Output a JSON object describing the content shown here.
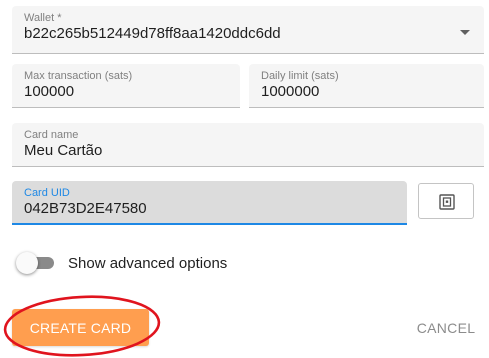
{
  "form": {
    "wallet": {
      "label": "Wallet *",
      "value": "b22c265b512449d78ff8aa1420ddc6dd"
    },
    "max_transaction": {
      "label": "Max transaction (sats)",
      "value": "100000"
    },
    "daily_limit": {
      "label": "Daily limit (sats)",
      "value": "1000000"
    },
    "card_name": {
      "label": "Card name",
      "value": "Meu Cartão"
    },
    "card_uid": {
      "label": "Card UID",
      "value": "042B73D2E47580"
    },
    "nfc_button_icon": "nfc-icon",
    "advanced_toggle": {
      "label": "Show advanced options",
      "checked": false
    }
  },
  "actions": {
    "create_label": "CREATE CARD",
    "cancel_label": "CANCEL"
  },
  "colors": {
    "accent": "#1e88e5",
    "create_button": "#ff9e4f",
    "annotation": "#e0141e"
  }
}
